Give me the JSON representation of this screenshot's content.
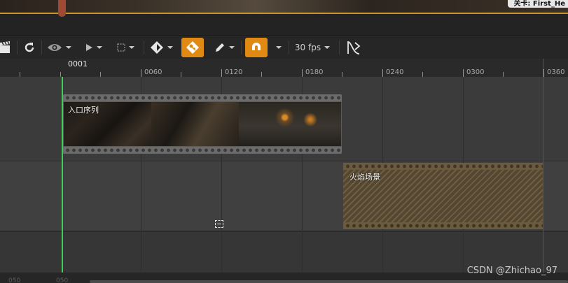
{
  "viewport": {
    "tooltip": "关卡: First_He"
  },
  "toolbar": {
    "fps_label": "30 fps"
  },
  "ruler": {
    "playhead_label": "0001",
    "ticks": [
      "0060",
      "0120",
      "0180",
      "0240",
      "0300",
      "0360"
    ]
  },
  "tracks": {
    "clip1_label": "入口序列",
    "clip2_label": "火焰场景"
  },
  "bottom": {
    "left_num_1": "050",
    "left_num_2": "050"
  },
  "watermark": "CSDN @Zhichao_97",
  "colors": {
    "accent_orange": "#e08a14",
    "playhead_green": "#3ecf55",
    "end_marker_red": "#a83232",
    "playhead_handle": "#a04a36"
  },
  "icons": [
    "clapperboard-icon",
    "refresh-icon",
    "eye-icon",
    "play-icon",
    "selection-icon",
    "key-icon",
    "key-orange-icon",
    "pencil-icon",
    "magnet-icon",
    "curve-icon"
  ]
}
